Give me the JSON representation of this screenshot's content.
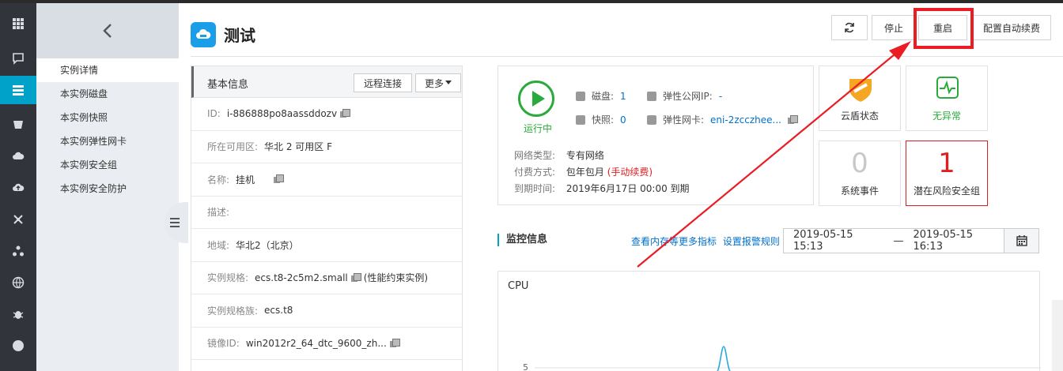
{
  "header": {
    "title": "测试",
    "buttons": {
      "stop": "停止",
      "restart": "重启",
      "auto_renew": "配置自动续费"
    }
  },
  "subnav": {
    "items": [
      "实例详情",
      "本实例磁盘",
      "本实例快照",
      "本实例弹性网卡",
      "本实例安全组",
      "本实例安全防护"
    ]
  },
  "basic_info": {
    "title": "基本信息",
    "remote_btn": "远程连接",
    "more_btn": "更多",
    "rows": [
      {
        "k": "ID:",
        "v": "i-886888po8aassddozv"
      },
      {
        "k": "所在可用区:",
        "v": "华北 2 可用区 F"
      },
      {
        "k": "名称:",
        "v": "挂机"
      },
      {
        "k": "描述:",
        "v": ""
      },
      {
        "k": "地域:",
        "v": "华北2（北京）"
      },
      {
        "k": "实例规格:",
        "v": "ecs.t8-2c5m2.small",
        "extra": "(性能约束实例)"
      },
      {
        "k": "实例规格族:",
        "v": "ecs.t8"
      },
      {
        "k": "镜像ID:",
        "v": "win2012r2_64_dtc_9600_zh..."
      }
    ]
  },
  "status": {
    "run_label": "运行中",
    "disk_label": "磁盘:",
    "disk_count": "1",
    "snapshot_label": "快照:",
    "snapshot_count": "0",
    "eip_label": "弹性公网IP:",
    "eip_value": "-",
    "eni_label": "弹性网卡:",
    "eni_value": "eni-2zcczhee...",
    "network_k": "网络类型:",
    "network_v": "专有网络",
    "pay_k": "付费方式:",
    "pay_v": "包年包月",
    "pay_note": "(手动续费)",
    "expire_k": "到期时间:",
    "expire_v": "2019年6月17日 00:00 到期"
  },
  "tiles": {
    "shield": "云盾状态",
    "normal": "无异常",
    "events_num": "0",
    "events": "系统事件",
    "risk_num": "1",
    "risk": "潜在风险安全组"
  },
  "monitor": {
    "title": "监控信息",
    "link_more": "查看内存等更多指标",
    "link_alarm": "设置报警规则",
    "date_from": "2019-05-15 15:13",
    "date_sep": "—",
    "date_to": "2019-05-15 16:13",
    "chart_title": "CPU",
    "y_tick": "5"
  },
  "colors": {
    "accent": "#00a2ca",
    "highlight": "#ea1c24",
    "running": "#2aaa3a",
    "link": "#0070cc"
  }
}
